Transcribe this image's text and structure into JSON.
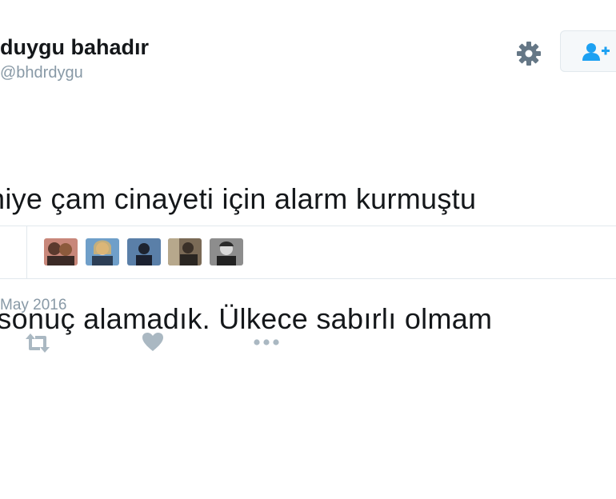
{
  "profile": {
    "display_name": "duygu bahadır",
    "handle": "@bhdrdygu"
  },
  "header_icons": {
    "settings": "gear-icon",
    "follow": "add-user-icon"
  },
  "tweet": {
    "line1": "niye çam cinayeti için alarm kurmuştu",
    "line2": " sonuç alamadık. Ülkece sabırlı olmam",
    "line3": "."
  },
  "likers": [
    {
      "name": "liker-avatar-1",
      "bg": "#c8877a"
    },
    {
      "name": "liker-avatar-2",
      "bg": "#6f9fc9"
    },
    {
      "name": "liker-avatar-3",
      "bg": "#5a7fa8"
    },
    {
      "name": "liker-avatar-4",
      "bg": "#7a6a56"
    },
    {
      "name": "liker-avatar-5",
      "bg": "#8d8d8d"
    }
  ],
  "timestamp": "May 2016",
  "actions": {
    "retweet": "retweet-icon",
    "like": "heart-icon",
    "more": "more-icon"
  },
  "colors": {
    "text": "#14171a",
    "muted": "#8899a6",
    "accent": "#1da1f2",
    "icon": "#657786",
    "border": "#e1e8ed"
  }
}
